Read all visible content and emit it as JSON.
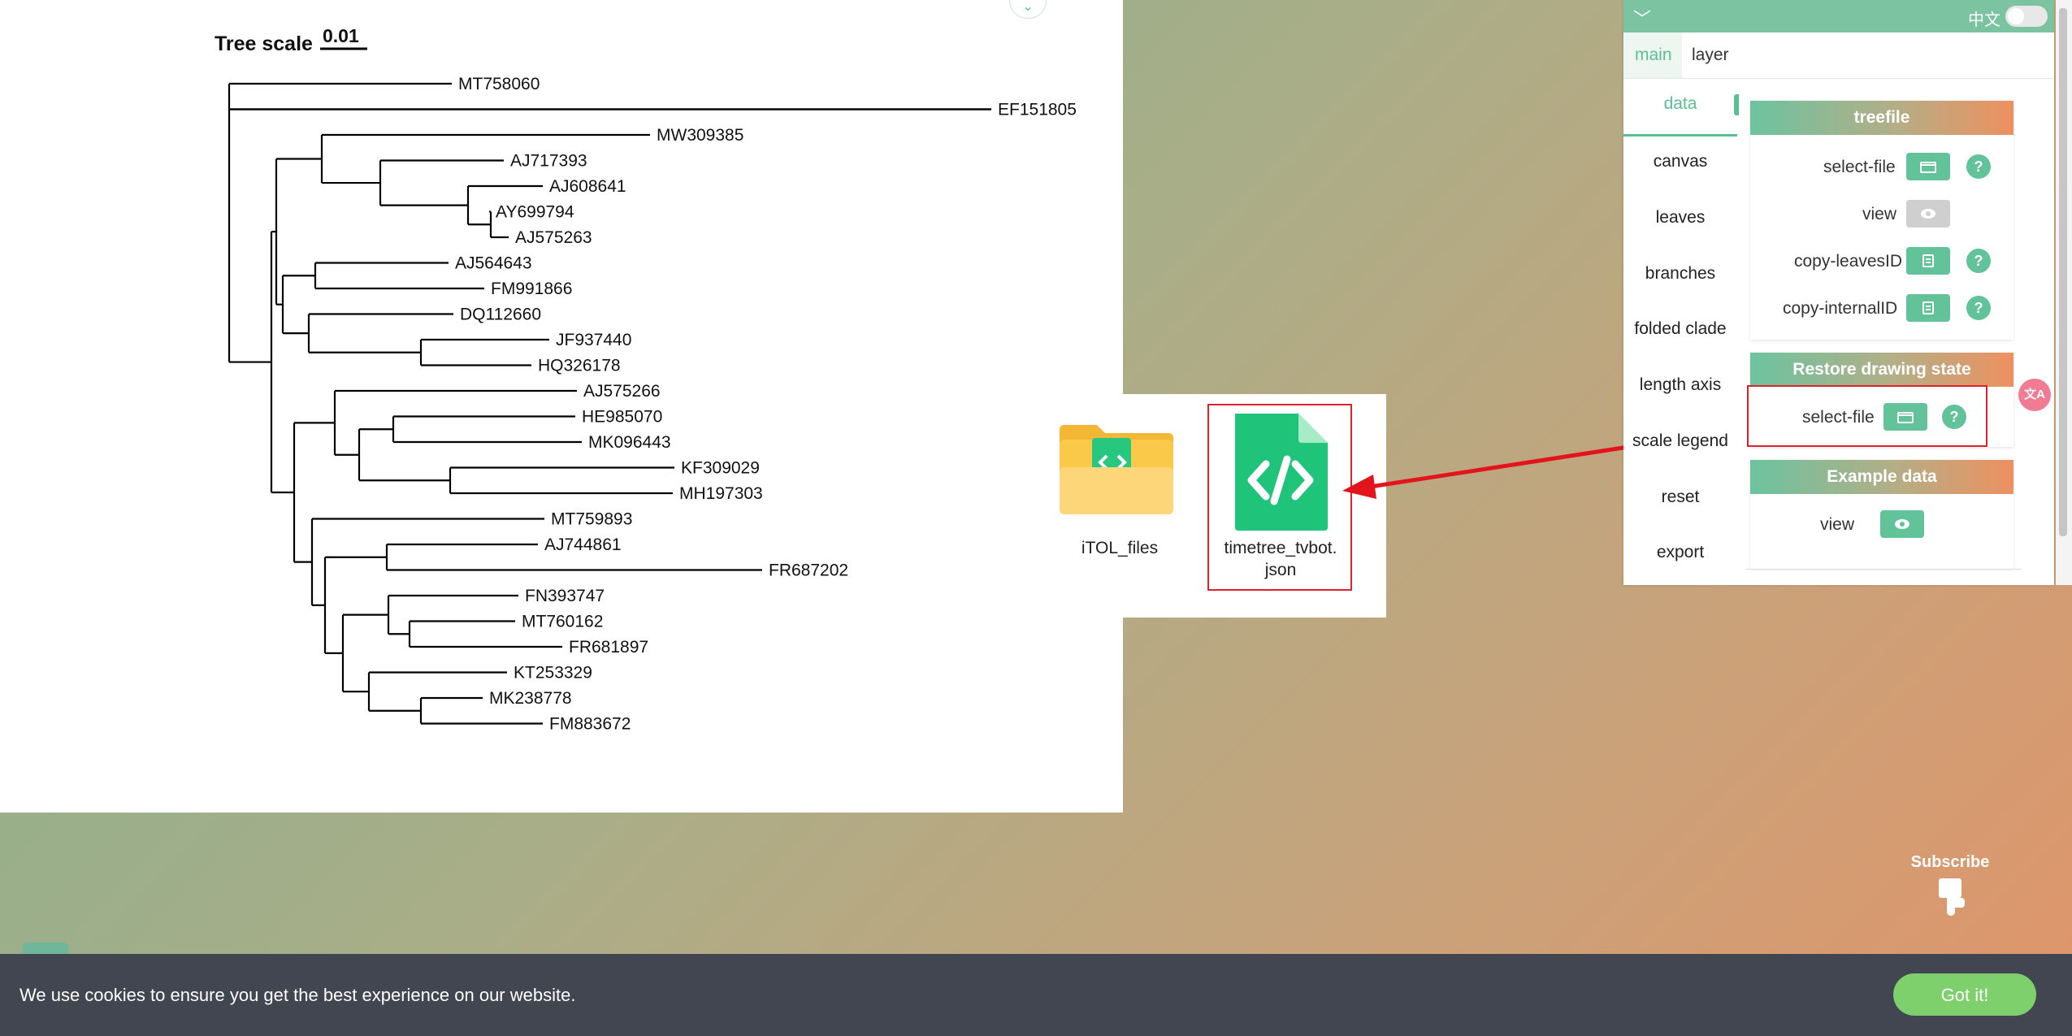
{
  "tree": {
    "scale_title": "Tree scale",
    "scale_value": "0.01",
    "leaves": [
      "MT758060",
      "EF151805",
      "MW309385",
      "AJ717393",
      "AJ608641",
      "AY699794",
      "AJ575263",
      "AJ564643",
      "FM991866",
      "DQ112660",
      "JF937440",
      "HQ326178",
      "AJ575266",
      "HE985070",
      "MK096443",
      "KF309029",
      "MH197303",
      "MT759893",
      "AJ744861",
      "FR687202",
      "FN393747",
      "MT760162",
      "FR681897",
      "KT253329",
      "MK238778",
      "FM883672"
    ]
  },
  "explorer": {
    "folder_name": "iTOL_files",
    "file_name_line1": "timetree_tvbot.",
    "file_name_line2": "json",
    "folder_icon": "folder-icon",
    "file_icon": "code-file-icon"
  },
  "panel": {
    "lang_label": "中文",
    "tabs": [
      {
        "label": "main"
      },
      {
        "label": "layer"
      }
    ],
    "nav": [
      {
        "label": "data"
      },
      {
        "label": "canvas"
      },
      {
        "label": "leaves"
      },
      {
        "label": "branches"
      },
      {
        "label": "folded clade"
      },
      {
        "label": "length axis"
      },
      {
        "label": "scale legend"
      },
      {
        "label": "reset"
      },
      {
        "label": "export"
      }
    ],
    "treefile": {
      "title": "treefile",
      "select_file": "select-file",
      "view": "view",
      "copy_leaves": "copy-leavesID",
      "copy_internal": "copy-internalID"
    },
    "restore": {
      "title": "Restore drawing state",
      "select_file": "select-file"
    },
    "example": {
      "title": "Example data",
      "view": "view"
    },
    "help_glyph": "?"
  },
  "translate_badge": "文A",
  "subscribe": {
    "label": "Subscribe"
  },
  "cookie": {
    "message": "We use cookies to ensure you get the best experience on our website.",
    "button": "Got it!"
  }
}
